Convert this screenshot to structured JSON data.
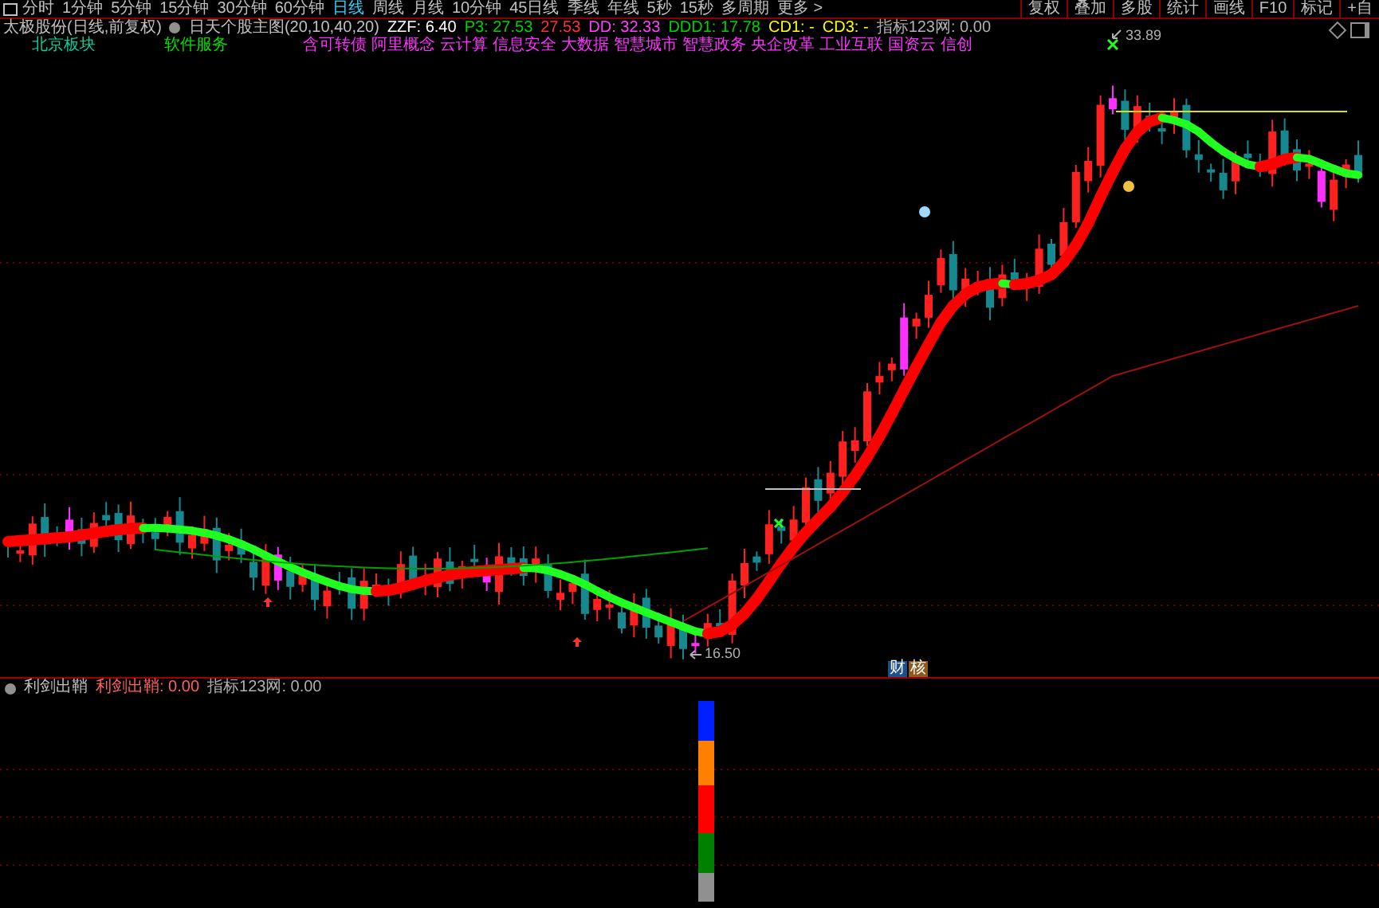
{
  "toolbar": {
    "tabs": [
      {
        "label": "分时",
        "selected": false
      },
      {
        "label": "1分钟",
        "selected": false
      },
      {
        "label": "5分钟",
        "selected": false
      },
      {
        "label": "15分钟",
        "selected": false
      },
      {
        "label": "30分钟",
        "selected": false
      },
      {
        "label": "60分钟",
        "selected": false
      },
      {
        "label": "日线",
        "selected": true
      },
      {
        "label": "周线",
        "selected": false
      },
      {
        "label": "月线",
        "selected": false
      },
      {
        "label": "10分钟",
        "selected": false
      },
      {
        "label": "45日线",
        "selected": false
      },
      {
        "label": "季线",
        "selected": false
      },
      {
        "label": "年线",
        "selected": false
      },
      {
        "label": "5秒",
        "selected": false
      },
      {
        "label": "15秒",
        "selected": false
      },
      {
        "label": "多周期",
        "selected": false
      },
      {
        "label": "更多 >",
        "selected": false
      }
    ],
    "buttons": [
      "复权",
      "叠加",
      "多股",
      "统计",
      "画线",
      "F10",
      "标记",
      "+自"
    ]
  },
  "chart_header": {
    "stock": "太极股份(日线,前复权)",
    "indicator": "日天个股主图(20,10,40,20)",
    "values": [
      {
        "text": "ZZF: 6.40",
        "color": "#ffffff"
      },
      {
        "text": "P3: 27.53",
        "color": "#00d000"
      },
      {
        "text": "27.53",
        "color": "#ff3030"
      },
      {
        "text": "DD: 32.33",
        "color": "#ff40ff"
      },
      {
        "text": "DDD1: 17.78",
        "color": "#00d000"
      },
      {
        "text": "CD1: -",
        "color": "#ffff00"
      },
      {
        "text": "CD3: -",
        "color": "#ffff00"
      },
      {
        "text": "指标123网: 0.00",
        "color": "#b0b0b0"
      }
    ]
  },
  "sector_tags": [
    {
      "label": "北京板块",
      "color": "#00d0a0"
    },
    {
      "label": "软件服务",
      "color": "#00e000"
    },
    {
      "label": "含可转债",
      "color": "#ff30ff"
    },
    {
      "label": "阿里概念",
      "color": "#ff30ff"
    },
    {
      "label": "云计算",
      "color": "#ff30ff"
    },
    {
      "label": "信息安全",
      "color": "#ff30ff"
    },
    {
      "label": "大数据",
      "color": "#ff30ff"
    },
    {
      "label": "智慧城市",
      "color": "#ff30ff"
    },
    {
      "label": "智慧政务",
      "color": "#ff30ff"
    },
    {
      "label": "央企改革",
      "color": "#ff30ff"
    },
    {
      "label": "工业互联",
      "color": "#ff30ff"
    },
    {
      "label": "国资云",
      "color": "#ff30ff"
    },
    {
      "label": "信创",
      "color": "#ff30ff"
    }
  ],
  "price_labels": {
    "high": "33.89",
    "low": "16.50"
  },
  "badges": [
    {
      "label": "财",
      "color": "#1e4f8a"
    },
    {
      "label": "核",
      "color": "#8a5a20"
    }
  ],
  "sub_panel": {
    "title": "利剑出鞘",
    "values": [
      {
        "text": "利剑出鞘: 0.00",
        "color": "#ff6060"
      },
      {
        "text": "指标123网: 0.00",
        "color": "#b0b0b0"
      }
    ]
  }
}
